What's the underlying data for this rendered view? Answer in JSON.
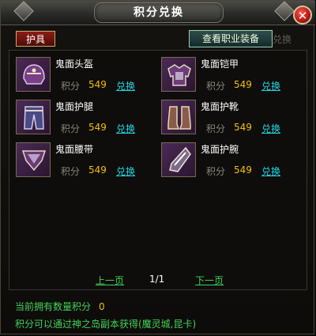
{
  "window": {
    "title": "积分兑换",
    "close_label": "✕"
  },
  "toolbar": {
    "armor_tab": "护具",
    "view_job_equipment": "查看职业装备",
    "ghost_text": "兑换"
  },
  "items": [
    {
      "name": "鬼面头盔",
      "points_label": "积分",
      "points": "549",
      "exchange": "兑换",
      "icon": "helmet-icon"
    },
    {
      "name": "鬼面铠甲",
      "points_label": "积分",
      "points": "549",
      "exchange": "兑换",
      "icon": "armor-icon"
    },
    {
      "name": "鬼面护腿",
      "points_label": "积分",
      "points": "549",
      "exchange": "兑换",
      "icon": "leggings-icon"
    },
    {
      "name": "鬼面护靴",
      "points_label": "积分",
      "points": "549",
      "exchange": "兑换",
      "icon": "boots-icon"
    },
    {
      "name": "鬼面腰带",
      "points_label": "积分",
      "points": "549",
      "exchange": "兑换",
      "icon": "belt-icon"
    },
    {
      "name": "鬼面护腕",
      "points_label": "积分",
      "points": "549",
      "exchange": "兑换",
      "icon": "bracer-icon"
    }
  ],
  "pager": {
    "prev": "上一页",
    "page": "1/1",
    "next": "下一页"
  },
  "footer": {
    "owned_label": "当前拥有数量积分",
    "owned_value": "0",
    "hint": "积分可以通过神之岛副本获得(魔灵城,昆卡)"
  },
  "colors": {
    "points": "#f2c000",
    "exchange_link": "#22d5e0",
    "green_text": "#41d25a"
  }
}
